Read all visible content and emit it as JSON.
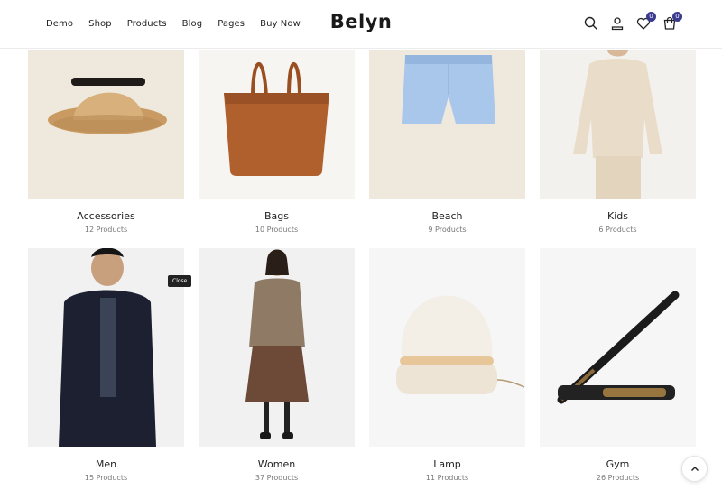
{
  "nav": {
    "items": [
      "Demo",
      "Shop",
      "Products",
      "Blog",
      "Pages",
      "Buy Now"
    ]
  },
  "brand": {
    "logo": "Belyn"
  },
  "header_icons": {
    "wishlist_count": "0",
    "cart_count": "0"
  },
  "categories": [
    {
      "name": "Accessories",
      "count": "12 Products",
      "icon": "straw-hat-image"
    },
    {
      "name": "Bags",
      "count": "10 Products",
      "icon": "leather-tote-image"
    },
    {
      "name": "Beach",
      "count": "9 Products",
      "icon": "blue-shorts-image"
    },
    {
      "name": "Kids",
      "count": "6 Products",
      "icon": "kid-sweater-image"
    },
    {
      "name": "Men",
      "count": "15 Products",
      "icon": "man-fur-jacket-image"
    },
    {
      "name": "Women",
      "count": "37 Products",
      "icon": "woman-cardigan-image"
    },
    {
      "name": "Lamp",
      "count": "11 Products",
      "icon": "dome-lamp-image"
    },
    {
      "name": "Gym",
      "count": "26 Products",
      "icon": "baseball-bat-image"
    }
  ],
  "tooltip": {
    "close_label": "Close"
  },
  "colors": {
    "accent": "#3b3b8e",
    "card_bg": "#f0ebe1"
  }
}
